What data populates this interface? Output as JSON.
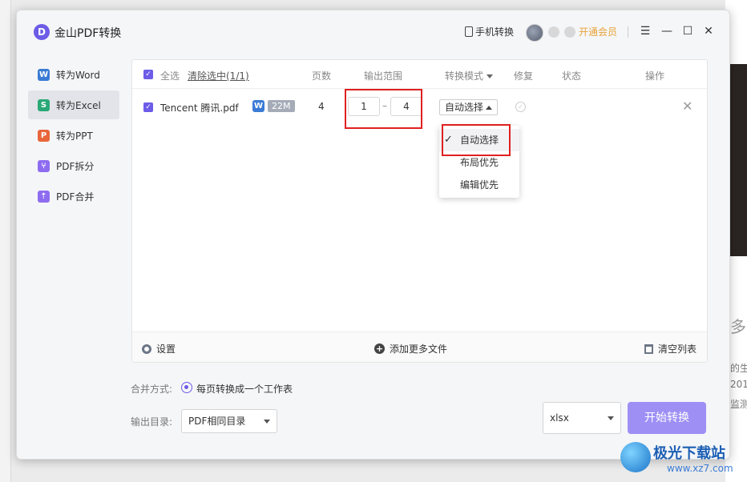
{
  "app": {
    "title": "金山PDF转换",
    "logo_letter": "D"
  },
  "titlebar": {
    "phone_convert": "手机转换",
    "vip": "开通会员",
    "menu_icon": "☰",
    "minimize_icon": "—",
    "maximize_icon": "☐",
    "close_icon": "✕"
  },
  "sidebar": {
    "items": [
      {
        "label": "转为Word",
        "icon": "W",
        "color": "#3a7bd5",
        "active": false
      },
      {
        "label": "转为Excel",
        "icon": "S",
        "color": "#2aa876",
        "active": true
      },
      {
        "label": "转为PPT",
        "icon": "P",
        "color": "#e8663a",
        "active": false
      },
      {
        "label": "PDF拆分",
        "icon": "⑂",
        "color": "#8e6cf0",
        "active": false
      },
      {
        "label": "PDF合并",
        "icon": "⇡",
        "color": "#8e6cf0",
        "active": false
      }
    ]
  },
  "table": {
    "headers": {
      "select_all": "全选",
      "clear_selected": "清除选中(1/1)",
      "pages": "页数",
      "range": "输出范围",
      "mode": "转换模式",
      "repair": "修复",
      "status": "状态",
      "actions": "操作"
    },
    "rows": [
      {
        "filename": "Tencent 腾讯.pdf",
        "size": "22M",
        "pages": "4",
        "range_from": "1",
        "range_to": "4",
        "mode": "自动选择"
      }
    ],
    "range_separator": "–"
  },
  "mode_dropdown": {
    "options": [
      "自动选择",
      "布局优先",
      "编辑优先"
    ],
    "selected": "自动选择",
    "check": "✓"
  },
  "panel_footer": {
    "settings": "设置",
    "add_more": "添加更多文件",
    "clear_list": "清空列表"
  },
  "options": {
    "merge_label": "合并方式:",
    "merge_value": "每页转换成一个工作表",
    "output_dir_label": "输出目录:",
    "output_dir_value": "PDF相同目录",
    "format_value": "xlsx",
    "start_button": "开始转换"
  },
  "background": {
    "text_1": "多",
    "text_2": "的生",
    "text_3": "201",
    "text_4": "监测"
  },
  "watermark": {
    "title": "极光下载站",
    "sub": "www.xz7.com"
  },
  "colors": {
    "accent": "#6c5ce7",
    "vip": "#e8a33a",
    "highlight": "#e02020",
    "start_button": "#9e8ff5"
  }
}
